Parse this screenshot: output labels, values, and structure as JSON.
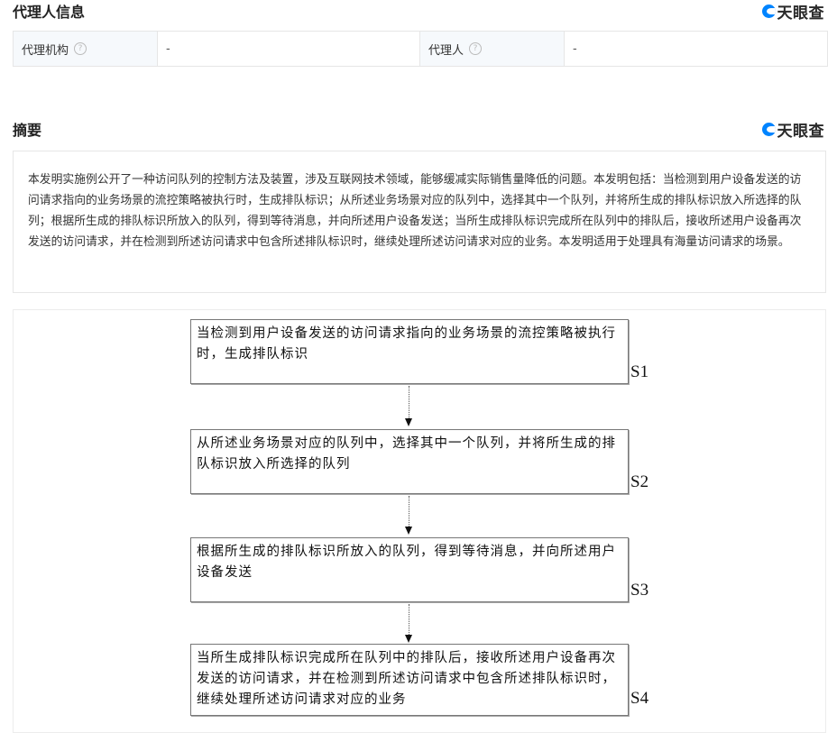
{
  "agent_section": {
    "title": "代理人信息",
    "brand": "天眼查",
    "rows": [
      {
        "label": "代理机构",
        "value": "-"
      },
      {
        "label": "代理人",
        "value": "-"
      }
    ]
  },
  "abstract_section": {
    "title": "摘要",
    "brand": "天眼查",
    "text": "本发明实施例公开了一种访问队列的控制方法及装置，涉及互联网技术领域，能够缓减实际销售量降低的问题。本发明包括：当检测到用户设备发送的访问请求指向的业务场景的流控策略被执行时，生成排队标识；从所述业务场景对应的队列中，选择其中一个队列，并将所生成的排队标识放入所选择的队列；根据所生成的排队标识所放入的队列，得到等待消息，并向所述用户设备发送；当所生成排队标识完成所在队列中的排队后，接收所述用户设备再次发送的访问请求，并在检测到所述访问请求中包含所述排队标识时，继续处理所述访问请求对应的业务。本发明适用于处理具有海量访问请求的场景。"
  },
  "flowchart": {
    "steps": [
      {
        "tag": "S1",
        "text": "当检测到用户设备发送的访问请求指向的业务场景的流控策略被执行时，生成排队标识"
      },
      {
        "tag": "S2",
        "text": "从所述业务场景对应的队列中，选择其中一个队列，并将所生成的排队标识放入所选择的队列"
      },
      {
        "tag": "S3",
        "text": "根据所生成的排队标识所放入的队列，得到等待消息，并向所述用户设备发送"
      },
      {
        "tag": "S4",
        "text": "当所生成排队标识完成所在队列中的排队后，接收所述用户设备再次发送的访问请求，并在检测到所述访问请求中包含所述排队标识时，继续处理所述访问请求对应的业务"
      }
    ]
  }
}
